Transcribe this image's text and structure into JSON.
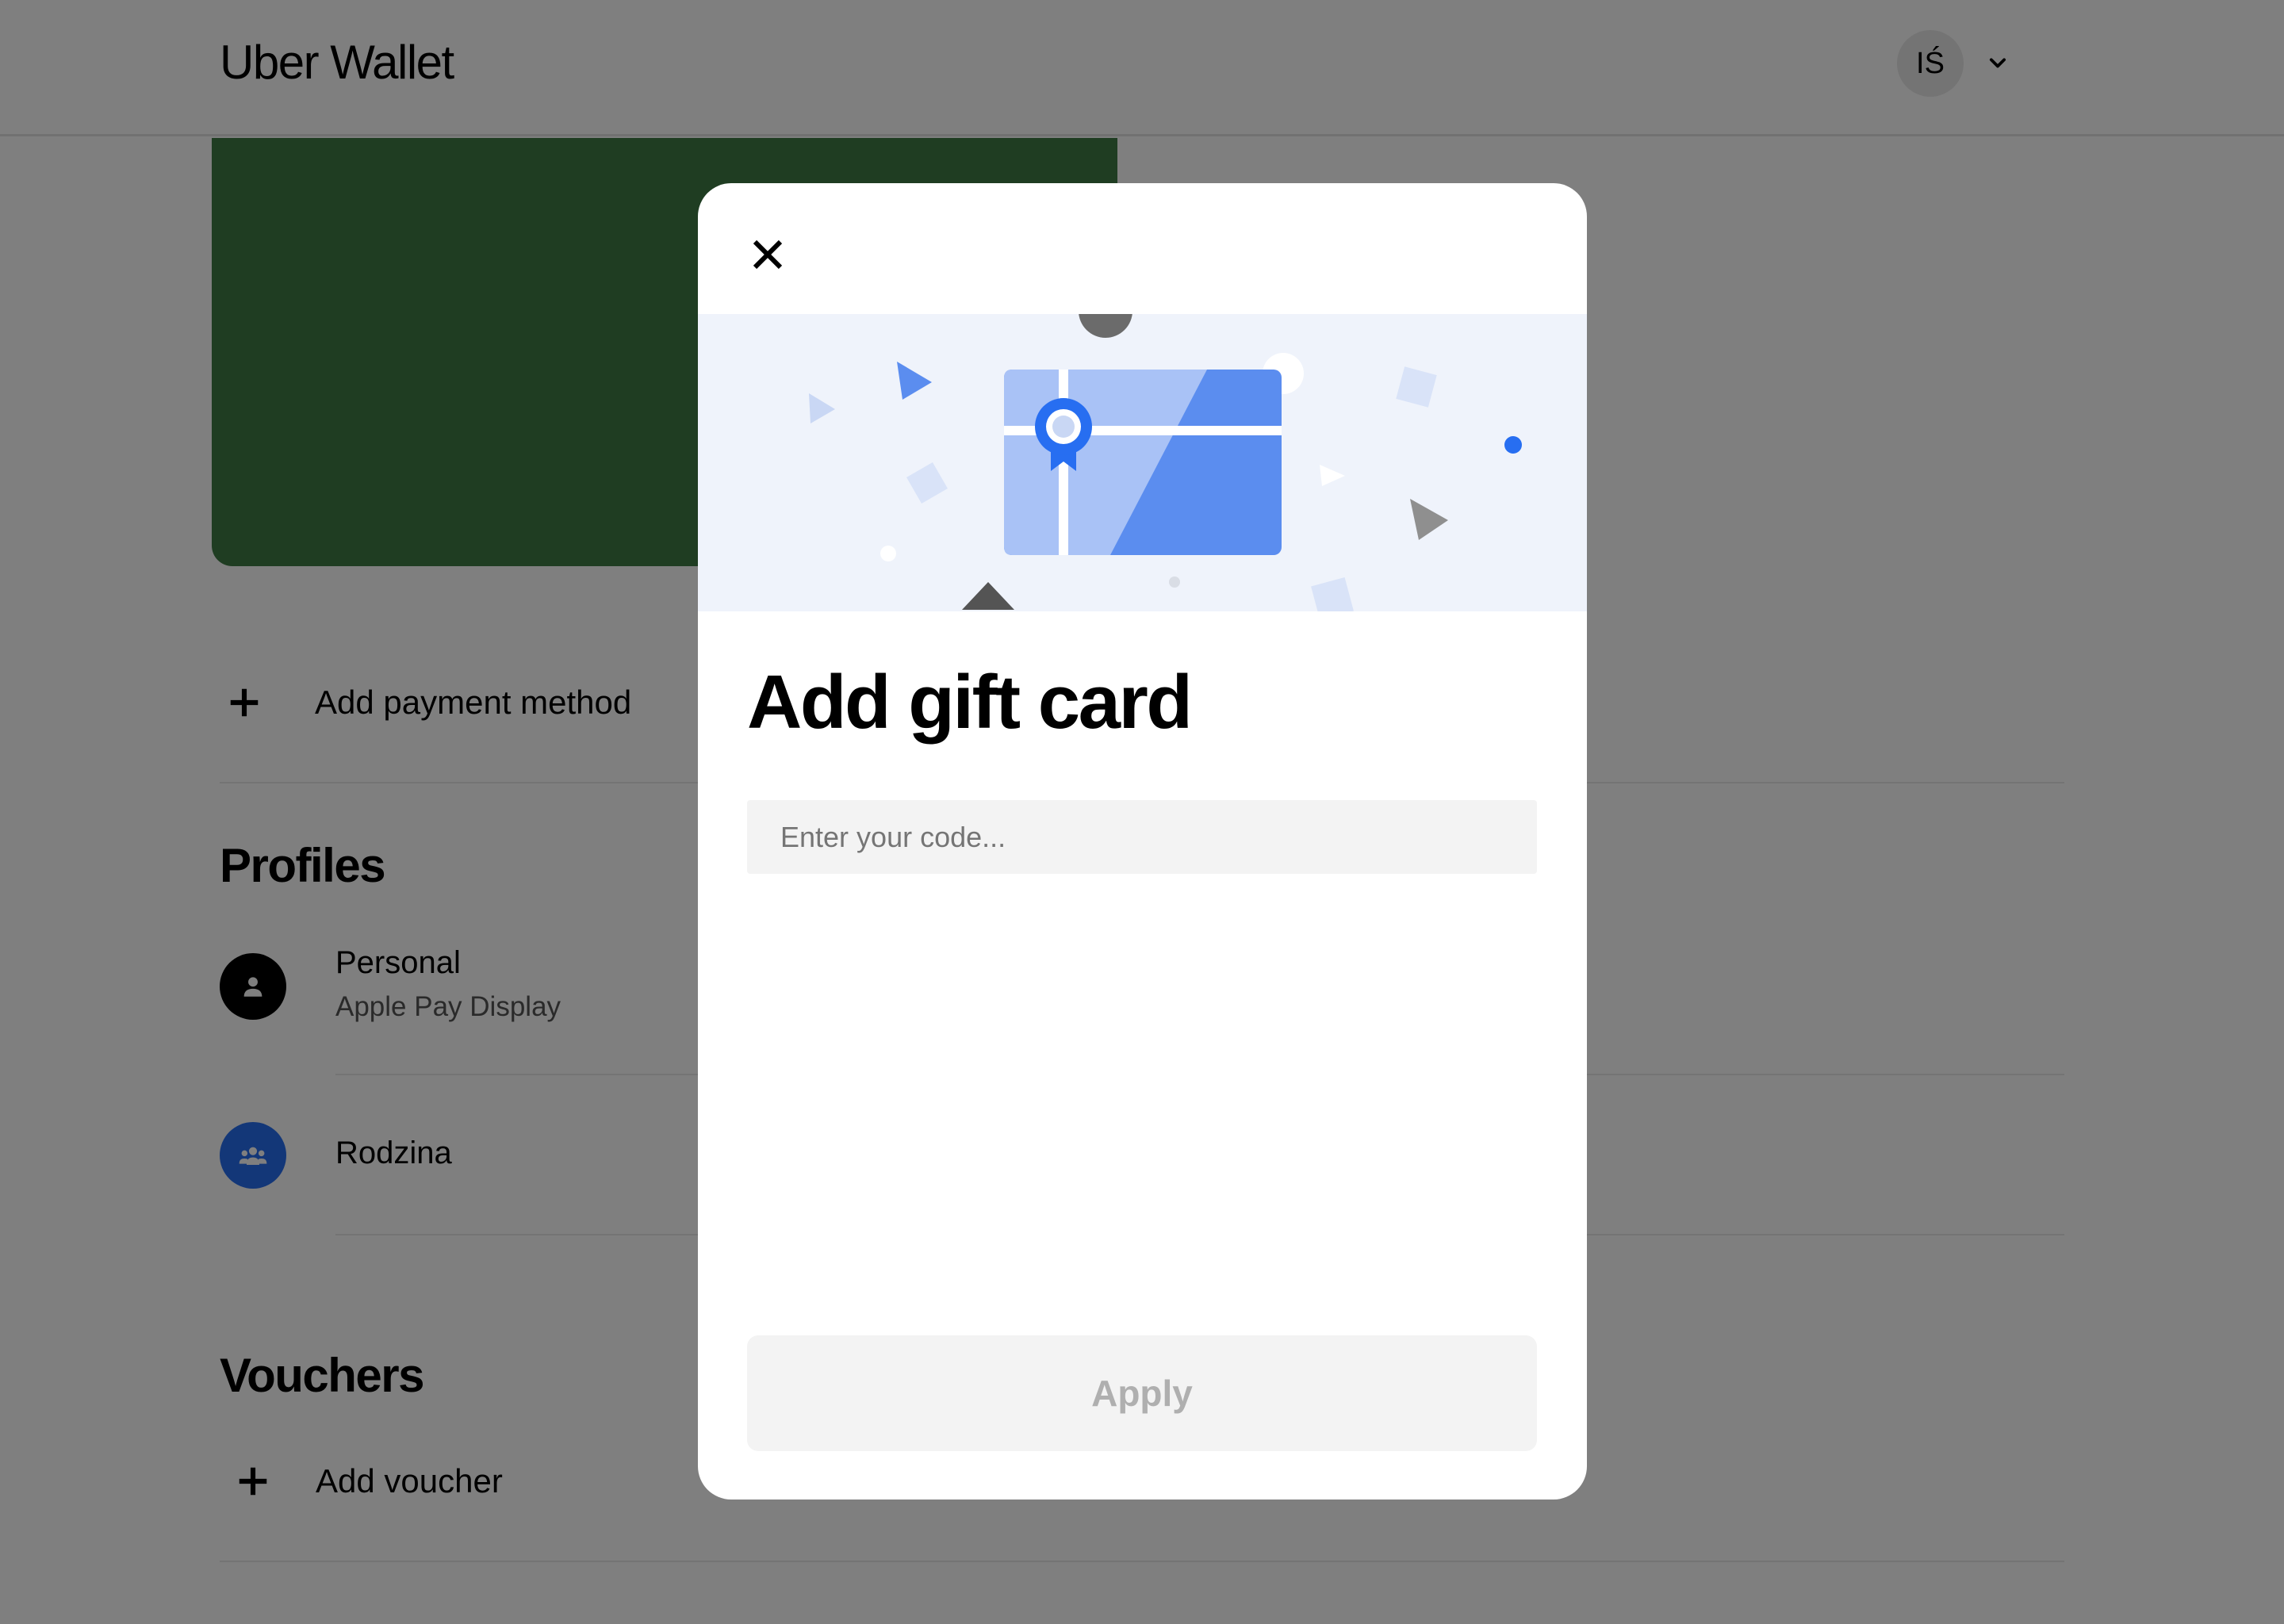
{
  "header": {
    "title": "Uber Wallet",
    "avatar_initials": "IŚ",
    "avatar_menu_icon": "chevron-down-icon"
  },
  "payment": {
    "card_color": "#3e7a44",
    "add_payment_label": "Add payment method"
  },
  "profiles": {
    "title": "Profiles",
    "items": [
      {
        "name": "Personal",
        "subtitle": "Apple Pay Display",
        "icon": "person-icon",
        "icon_color": "#000000"
      },
      {
        "name": "Rodzina",
        "subtitle": "",
        "icon": "family-icon",
        "icon_color": "#276ef1"
      }
    ]
  },
  "vouchers": {
    "title": "Vouchers",
    "add_voucher_label": "Add voucher"
  },
  "modal": {
    "close_icon": "close-icon",
    "illustration": "gift-card-illustration",
    "title": "Add gift card",
    "input_placeholder": "Enter your code...",
    "input_value": "",
    "apply_label": "Apply"
  },
  "colors": {
    "overlay": "rgba(0,0,0,0.5)",
    "accent_blue": "#276ef1",
    "illustration_bg": "#eff3fb",
    "disabled_text": "#afafaf"
  }
}
